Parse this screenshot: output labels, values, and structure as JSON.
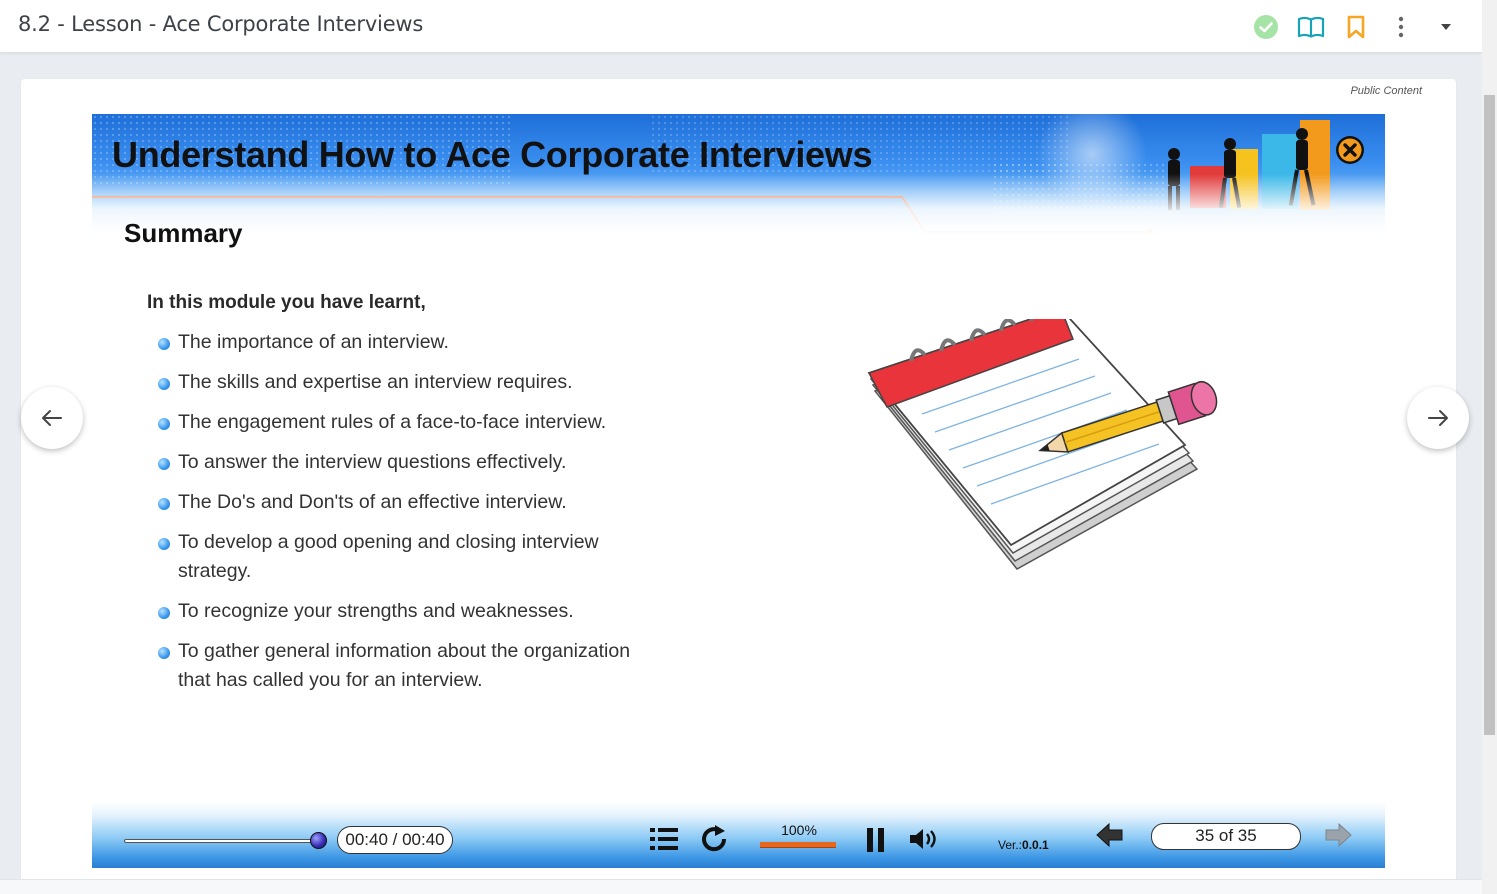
{
  "header": {
    "title": "8.2 - Lesson - Ace Corporate Interviews",
    "icons": [
      "check-circle-icon",
      "book-open-icon",
      "bookmark-icon",
      "more-vertical-icon",
      "caret-down-icon"
    ]
  },
  "card": {
    "visibility_label": "Public Content"
  },
  "slide": {
    "title": "Understand How to Ace Corporate Interviews",
    "section": "Summary",
    "intro": "In this module you have learnt,",
    "bullets": [
      "The importance of an interview.",
      "The skills and expertise an interview requires.",
      "The engagement rules of a face-to-face interview.",
      "To answer the interview questions effectively.",
      "The Do's and Don'ts of an effective interview.",
      "To develop a good opening and closing interview strategy.",
      "To recognize your strengths and weaknesses.",
      "To gather general information about the organization that has called you for an interview."
    ]
  },
  "player": {
    "time": "00:40 / 00:40",
    "progress_fraction": 1.0,
    "zoom": "100%",
    "version_prefix": "Ver.:",
    "version": "0.0.1",
    "page": "35 of 35"
  },
  "colors": {
    "accent_orange": "#e8671e",
    "check_green": "#8bd98b",
    "book_teal": "#17a2b8",
    "bookmark_orange": "#f5a623",
    "close_icon": "#1a1a1a"
  }
}
